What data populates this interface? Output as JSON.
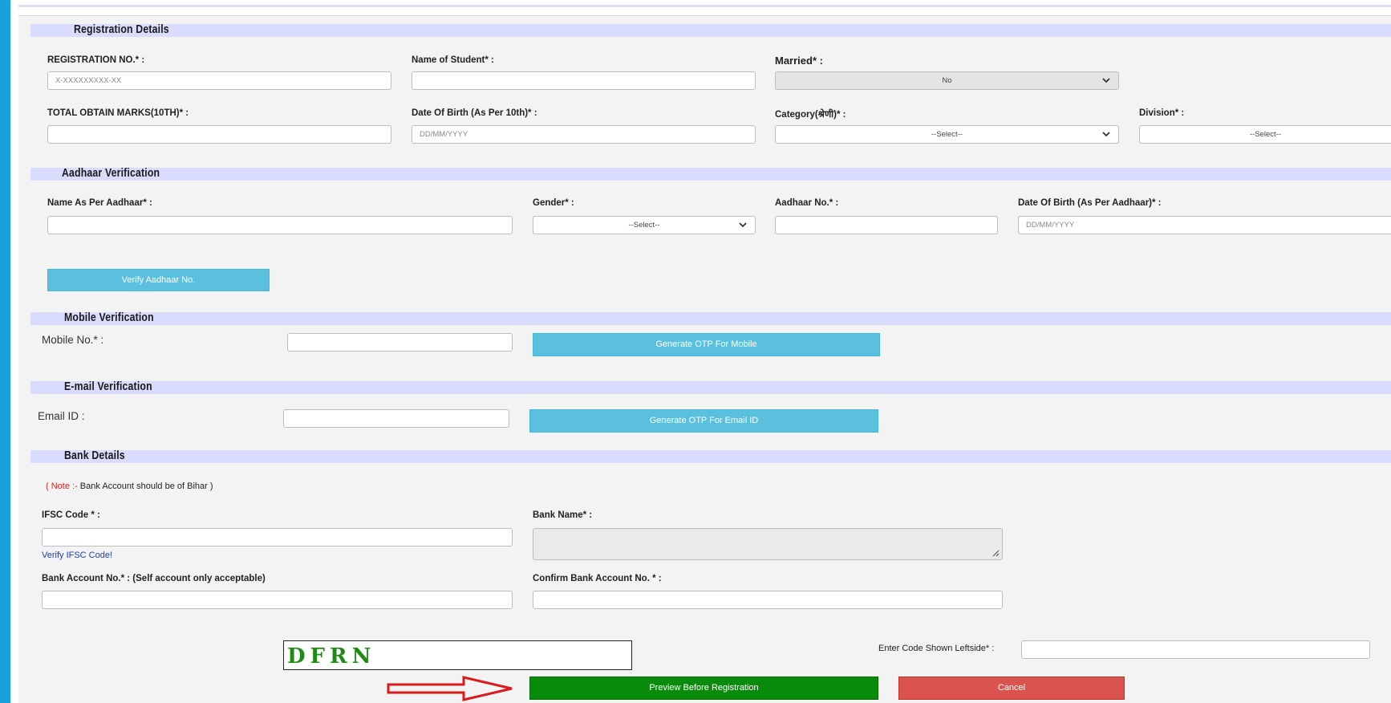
{
  "registration": {
    "section_title": "Registration Details",
    "reg_no_label": "REGISTRATION NO.* :",
    "reg_no_placeholder": "X-XXXXXXXXX-XX",
    "student_name_label": "Name of Student* :",
    "married_label": "Married* :",
    "married_value": "No",
    "marks_label": "TOTAL OBTAIN MARKS(10TH)* :",
    "dob_label": "Date Of Birth (As Per 10th)* :",
    "dob_placeholder": "DD/MM/YYYY",
    "category_label": "Category(श्रेणी)* :",
    "category_value": "--Select--",
    "division_label": "Division* :",
    "division_value": "--Select--"
  },
  "aadhaar": {
    "section_title": "Aadhaar Verification",
    "name_label": "Name As Per Aadhaar* :",
    "gender_label": "Gender* :",
    "gender_value": "--Select--",
    "aadhaar_no_label": "Aadhaar No.* :",
    "dob_label": "Date Of Birth (As Per Aadhaar)* :",
    "dob_placeholder": "DD/MM/YYYY",
    "verify_button": "Verify Aadhaar No."
  },
  "mobile": {
    "section_title": "Mobile Verification",
    "mobile_label": "Mobile No.* :",
    "otp_button": "Generate OTP For Mobile"
  },
  "email": {
    "section_title": "E-mail Verification",
    "email_label": "Email ID :",
    "otp_button": "Generate OTP For Email ID"
  },
  "bank": {
    "section_title": "Bank Details",
    "note_prefix": "( Note :- ",
    "note_text": "Bank Account should be of Bihar )",
    "ifsc_label": "IFSC Code * :",
    "verify_ifsc_link": "Verify IFSC Code!",
    "bank_name_label": "Bank Name* :",
    "account_label": "Bank Account No.* : (Self account only acceptable)",
    "confirm_account_label": "Confirm Bank Account No. * :"
  },
  "captcha": {
    "code": "DFRN",
    "enter_label": "Enter Code Shown Leftside* :"
  },
  "actions": {
    "preview_button": "Preview Before Registration",
    "cancel_button": "Cancel"
  },
  "colors": {
    "section_bar": "#d9dcfc",
    "blue_button": "#5bc0de",
    "green_button": "#0a8a0a",
    "red_button": "#d9534f",
    "arrow": "#d91b1b"
  },
  "icons": {
    "select_arrow": "chevron-down-icon",
    "annotation_arrow": "red-arrow-icon",
    "textarea_resize": "resize-handle-icon"
  }
}
